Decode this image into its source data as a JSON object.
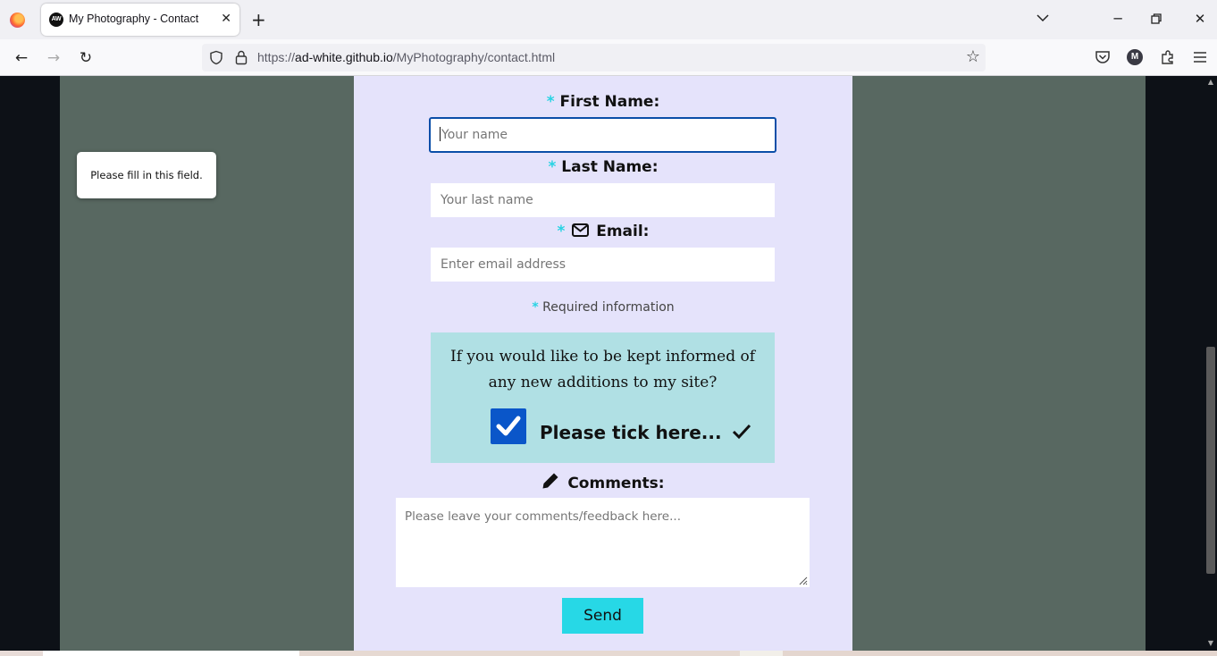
{
  "browser": {
    "tab_title": "My Photography - Contact",
    "tab_favicon_text": "AW",
    "url_prefix": "https://",
    "url_host": "ad-white.github.io",
    "url_path": "/MyPhotography/contact.html",
    "profile_initial": "M"
  },
  "form": {
    "first_name_label": "First Name:",
    "first_name_placeholder": "Your name",
    "validation_tooltip": "Please fill in this field.",
    "last_name_label": "Last Name:",
    "last_name_placeholder": "Your last name",
    "email_label": "Email:",
    "email_placeholder": "Enter email address",
    "required_star": "*",
    "required_note": "Required information",
    "notify_text": "If you would like to be kept informed of any new additions to my site?",
    "tick_label": "Please tick here...",
    "subscribe_checked": true,
    "comments_label": "Comments:",
    "comments_placeholder": "Please leave your comments/feedback here...",
    "send_label": "Send"
  },
  "colors": {
    "accent": "#27d8e6",
    "panel": "#e5e3fb",
    "notify_box": "#b0e0e4",
    "checkbox": "#0a56c9",
    "page_bg": "#586861"
  }
}
